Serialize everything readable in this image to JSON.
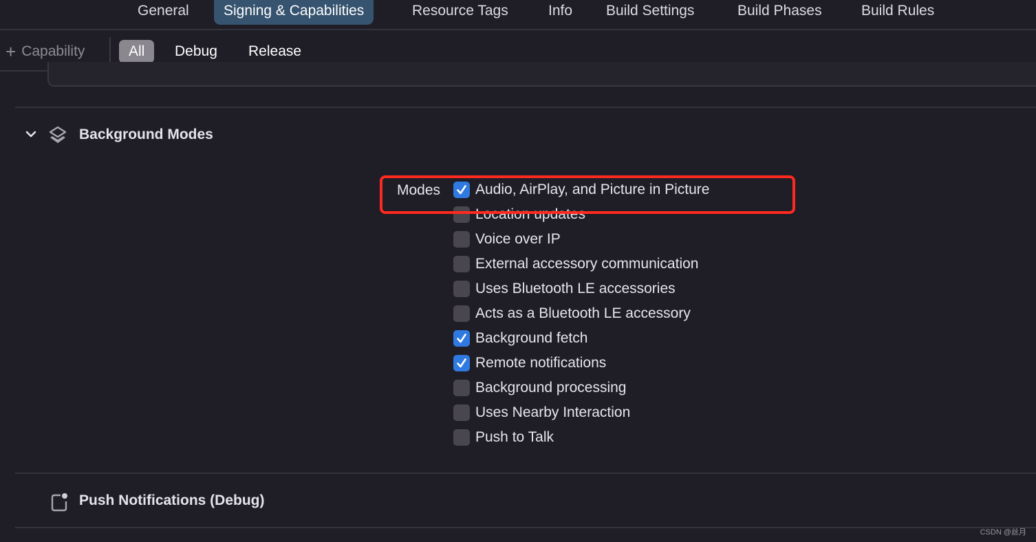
{
  "tabs": [
    {
      "label": "General",
      "active": false
    },
    {
      "label": "Signing & Capabilities",
      "active": true
    },
    {
      "label": "Resource Tags",
      "active": false
    },
    {
      "label": "Info",
      "active": false
    },
    {
      "label": "Build Settings",
      "active": false
    },
    {
      "label": "Build Phases",
      "active": false
    },
    {
      "label": "Build Rules",
      "active": false
    }
  ],
  "toolbar": {
    "add_capability_label": "Capability",
    "add_icon": "plus-icon",
    "filters": [
      {
        "label": "All",
        "active": true
      },
      {
        "label": "Debug",
        "active": false
      },
      {
        "label": "Release",
        "active": false
      }
    ]
  },
  "background_modes": {
    "title": "Background Modes",
    "icon": "layers-icon",
    "modes_label": "Modes",
    "modes": [
      {
        "label": "Audio, AirPlay, and Picture in Picture",
        "checked": true
      },
      {
        "label": "Location updates",
        "checked": false
      },
      {
        "label": "Voice over IP",
        "checked": false
      },
      {
        "label": "External accessory communication",
        "checked": false
      },
      {
        "label": "Uses Bluetooth LE accessories",
        "checked": false
      },
      {
        "label": "Acts as a Bluetooth LE accessory",
        "checked": false
      },
      {
        "label": "Background fetch",
        "checked": true
      },
      {
        "label": "Remote notifications",
        "checked": true
      },
      {
        "label": "Background processing",
        "checked": false
      },
      {
        "label": "Uses Nearby Interaction",
        "checked": false
      },
      {
        "label": "Push to Talk",
        "checked": false
      }
    ]
  },
  "push_notifications": {
    "title": "Push Notifications (Debug)",
    "icon": "notification-badge-icon"
  },
  "watermark": "CSDN @丝月",
  "colors": {
    "background": "#1f1d26",
    "active_tab": "#36536f",
    "checkbox_on": "#2f7ae0",
    "highlight_box": "#ff2a1f"
  }
}
